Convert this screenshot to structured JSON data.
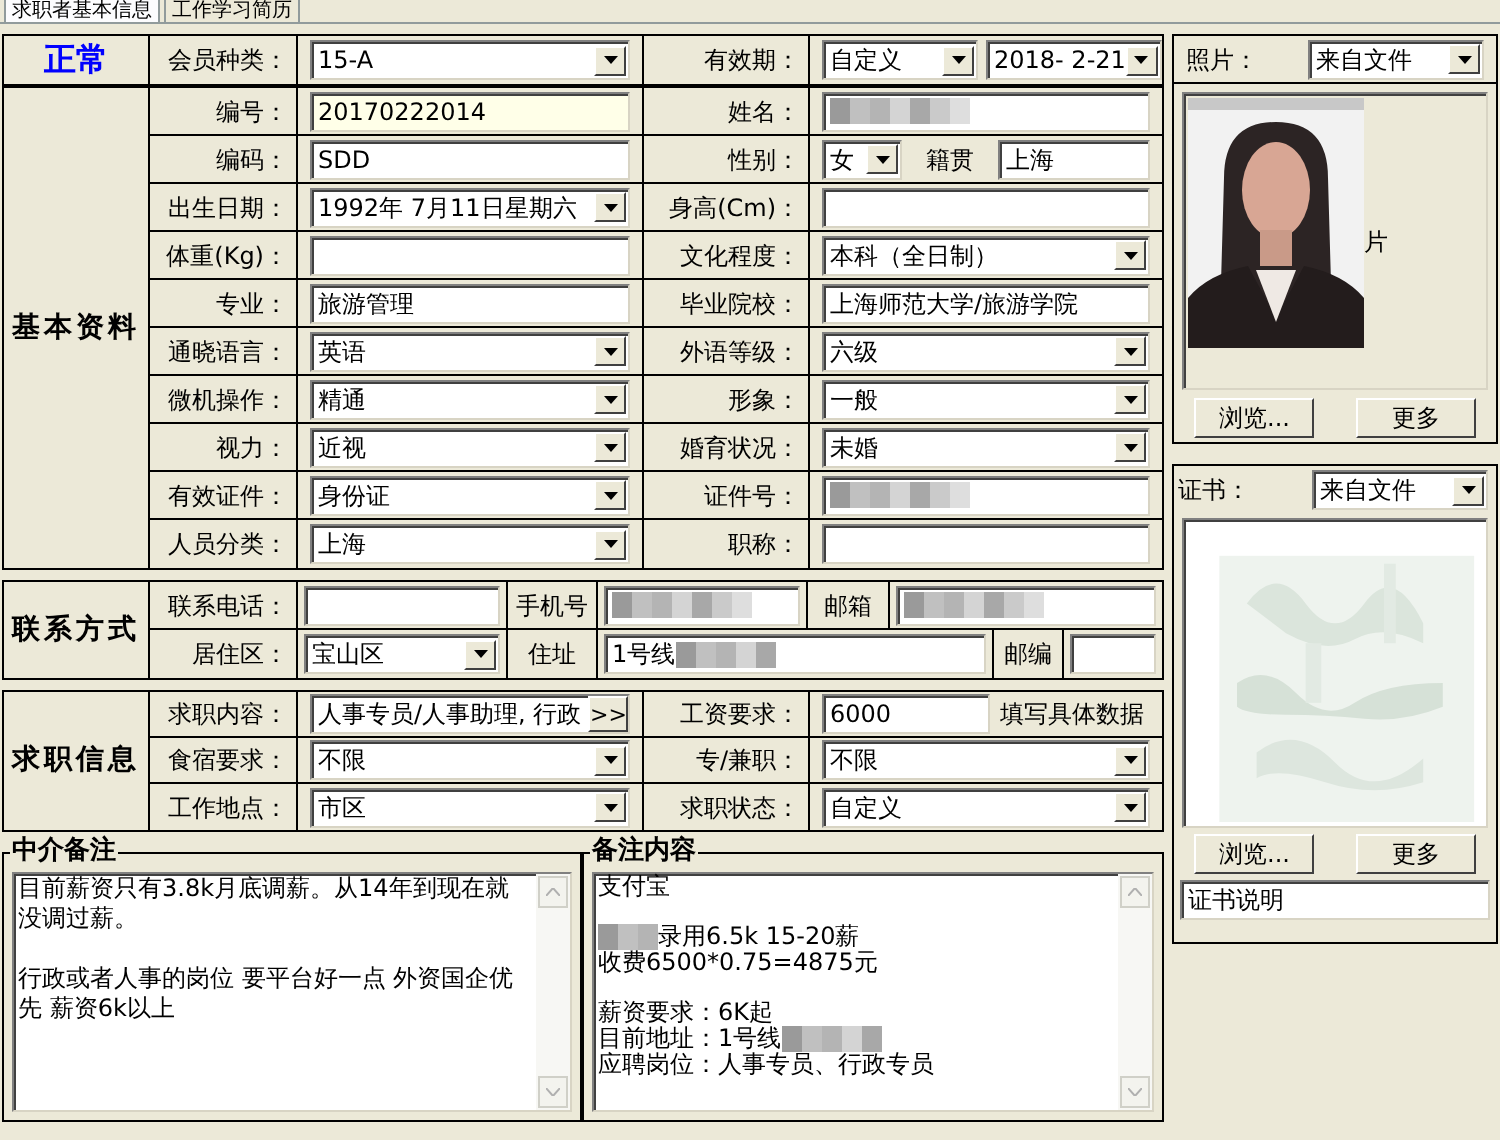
{
  "tabs": [
    {
      "label": "求职者基本信息",
      "selected": true
    },
    {
      "label": "工作学习简历",
      "selected": false
    }
  ],
  "header": {
    "status": "正常",
    "row": [
      {
        "label": "会员种类：",
        "field": {
          "kind": "select",
          "value": "15-A"
        }
      },
      {
        "label": "有效期：",
        "field": {
          "kind": "pair",
          "items": [
            {
              "kind": "select",
              "value": "自定义"
            },
            {
              "kind": "select",
              "value": "2018- 2-21"
            }
          ]
        }
      }
    ]
  },
  "basic": {
    "title": "基本资料",
    "rows": [
      [
        {
          "label": "编号：",
          "field": {
            "kind": "input",
            "value": "20170222014",
            "highlighted": true
          }
        },
        {
          "label": "姓名：",
          "field": {
            "kind": "redacted"
          }
        }
      ],
      [
        {
          "label": "编码：",
          "field": {
            "kind": "input",
            "value": "SDD"
          }
        },
        {
          "label": "性别：",
          "field": {
            "kind": "pair",
            "between": "籍贯",
            "items": [
              {
                "kind": "select",
                "value": "女"
              },
              {
                "kind": "input",
                "value": "上海"
              }
            ]
          }
        }
      ],
      [
        {
          "label": "出生日期：",
          "field": {
            "kind": "select",
            "value": "1992年 7月11日星期六"
          }
        },
        {
          "label": "身高(Cm)：",
          "field": {
            "kind": "input"
          }
        }
      ],
      [
        {
          "label": "体重(Kg)：",
          "field": {
            "kind": "input"
          }
        },
        {
          "label": "文化程度：",
          "field": {
            "kind": "select",
            "value": "本科（全日制）"
          }
        }
      ],
      [
        {
          "label": "专业：",
          "field": {
            "kind": "input",
            "value": "旅游管理"
          }
        },
        {
          "label": "毕业院校：",
          "field": {
            "kind": "input",
            "value": "上海师范大学/旅游学院"
          }
        }
      ],
      [
        {
          "label": "通晓语言：",
          "field": {
            "kind": "select",
            "value": "英语"
          }
        },
        {
          "label": "外语等级：",
          "field": {
            "kind": "select",
            "value": "六级"
          }
        }
      ],
      [
        {
          "label": "微机操作：",
          "field": {
            "kind": "select",
            "value": "精通"
          }
        },
        {
          "label": "形象：",
          "field": {
            "kind": "select",
            "value": "一般"
          }
        }
      ],
      [
        {
          "label": "视力：",
          "field": {
            "kind": "select",
            "value": "近视"
          }
        },
        {
          "label": "婚育状况：",
          "field": {
            "kind": "select",
            "value": "未婚"
          }
        }
      ],
      [
        {
          "label": "有效证件：",
          "field": {
            "kind": "select",
            "value": "身份证"
          }
        },
        {
          "label": "证件号：",
          "field": {
            "kind": "redacted"
          }
        }
      ],
      [
        {
          "label": "人员分类：",
          "field": {
            "kind": "select",
            "value": "上海"
          }
        },
        {
          "label": "职称：",
          "field": {
            "kind": "input"
          }
        }
      ]
    ]
  },
  "contact": {
    "title": "联系方式",
    "rows": [
      [
        {
          "label": "联系电话：",
          "field": {
            "kind": "input"
          }
        },
        {
          "label": "手机号",
          "field": {
            "kind": "redacted"
          }
        },
        {
          "label": "邮箱",
          "field": {
            "kind": "redacted"
          }
        }
      ],
      [
        {
          "label": "居住区：",
          "field": {
            "kind": "select",
            "value": "宝山区"
          }
        },
        {
          "label": "住址",
          "field": {
            "kind": "input",
            "value": "1号线",
            "redacted_tail": true
          }
        },
        {
          "label": "邮编",
          "field": {
            "kind": "input"
          }
        }
      ]
    ]
  },
  "job": {
    "title": "求职信息",
    "rows": [
      [
        {
          "label": "求职内容：",
          "field": {
            "kind": "picker",
            "value": "人事专员/人事助理, 行政",
            "button": ">>"
          }
        },
        {
          "label": "工资要求：",
          "field": {
            "kind": "input",
            "value": "6000",
            "note": "填写具体数据"
          }
        }
      ],
      [
        {
          "label": "食宿要求：",
          "field": {
            "kind": "select",
            "value": "不限"
          }
        },
        {
          "label": "专/兼职：",
          "field": {
            "kind": "select",
            "value": "不限"
          }
        }
      ],
      [
        {
          "label": "工作地点：",
          "field": {
            "kind": "select",
            "value": "市区"
          }
        },
        {
          "label": "求职状态：",
          "field": {
            "kind": "select",
            "value": "自定义"
          }
        }
      ]
    ]
  },
  "agent_note": {
    "title": "中介备注",
    "paragraphs": [
      "目前薪资只有3.8k月底调薪。从14年到现在就没调过薪。",
      "行政或者人事的岗位 要平台好一点 外资国企优先 薪资6k以上"
    ]
  },
  "remarks": {
    "title": "备注内容",
    "lines": [
      {
        "kind": "text",
        "text": "支付宝"
      },
      {
        "kind": "gap"
      },
      {
        "kind": "text",
        "text": "录用6.5k 15-20薪",
        "blur_before": true
      },
      {
        "kind": "text",
        "text": "收费6500*0.75=4875元"
      },
      {
        "kind": "gap"
      },
      {
        "kind": "text",
        "text": "薪资要求：6K起"
      },
      {
        "kind": "text",
        "text": "目前地址：1号线",
        "blur_after": true
      },
      {
        "kind": "text",
        "text": "应聘岗位：人事专员、行政专员"
      }
    ]
  },
  "photo": {
    "label": "照片：",
    "source": "来自文件",
    "caption": "片",
    "buttons": [
      "浏览...",
      "更多"
    ]
  },
  "certificate": {
    "label": "证书：",
    "source": "来自文件",
    "buttons": [
      "浏览...",
      "更多"
    ],
    "description": "证书说明"
  }
}
